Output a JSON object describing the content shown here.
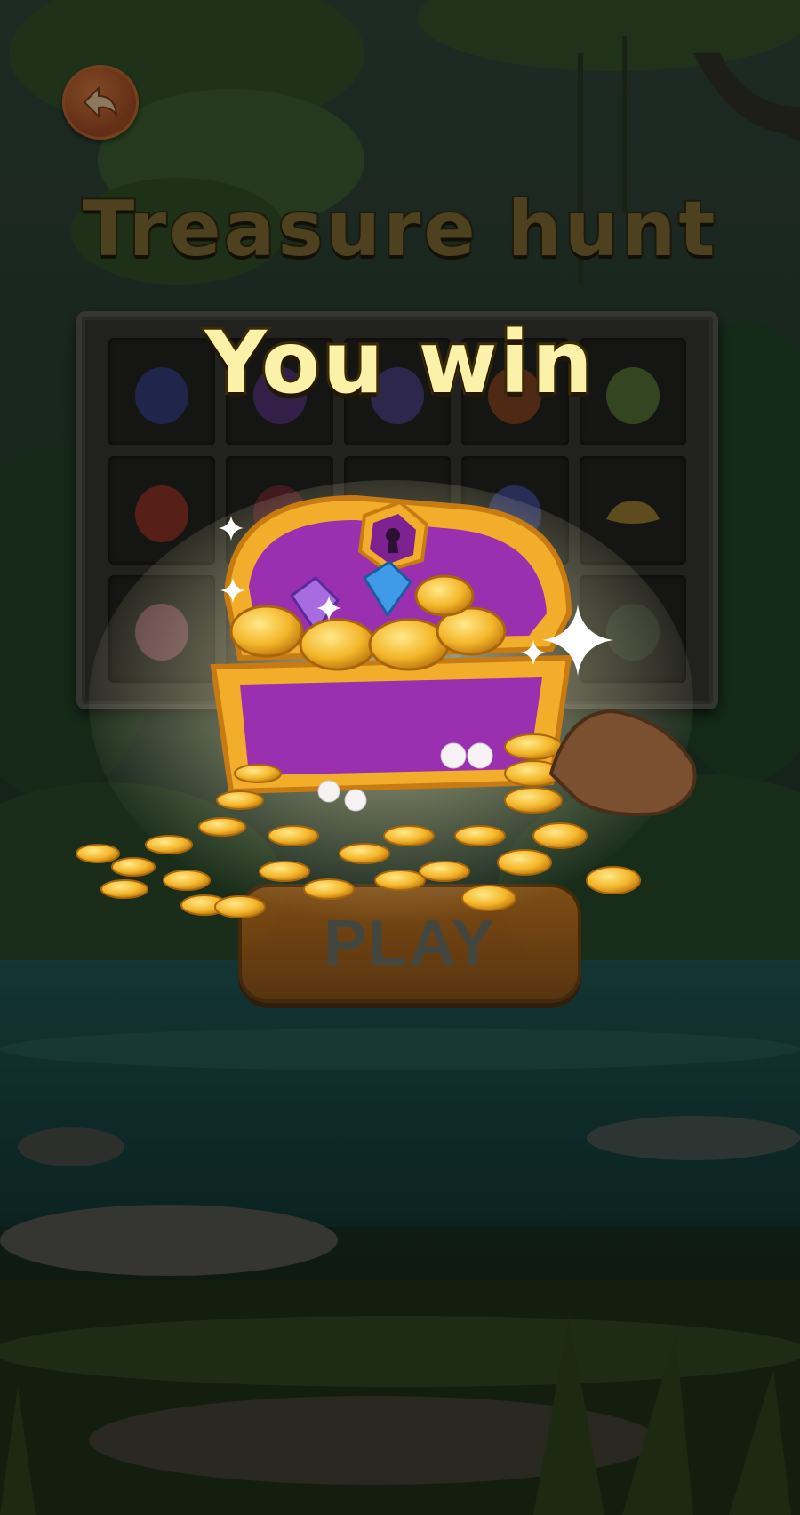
{
  "game": {
    "title": "Treasure hunt",
    "result_text": "You win",
    "play_label": "PLAY"
  },
  "board": {
    "rows": 3,
    "cols": 5,
    "tiles": [
      {
        "icon": "blue-fruit-icon"
      },
      {
        "icon": "purple-fruit-icon"
      },
      {
        "icon": "grape-fruit-icon"
      },
      {
        "icon": "orange-fruit-icon"
      },
      {
        "icon": "green-fruit-icon"
      },
      {
        "icon": "red-gem-icon"
      },
      {
        "icon": "spiky-fruit-icon"
      },
      {
        "icon": "gold-ingot-icon"
      },
      {
        "icon": "berry-fruit-icon"
      },
      {
        "icon": "gold-ingot-icon"
      },
      {
        "icon": "striped-fruit-icon"
      },
      {
        "icon": "empty"
      },
      {
        "icon": "empty"
      },
      {
        "icon": "empty"
      },
      {
        "icon": "dark-fruit-icon"
      }
    ]
  },
  "colors": {
    "title_fill": "#6b5a2c",
    "win_fill": "#fbf1a8",
    "play_button": "#c7741e",
    "chest_purple": "#9a2fb0",
    "chest_gold": "#f4b62a"
  }
}
